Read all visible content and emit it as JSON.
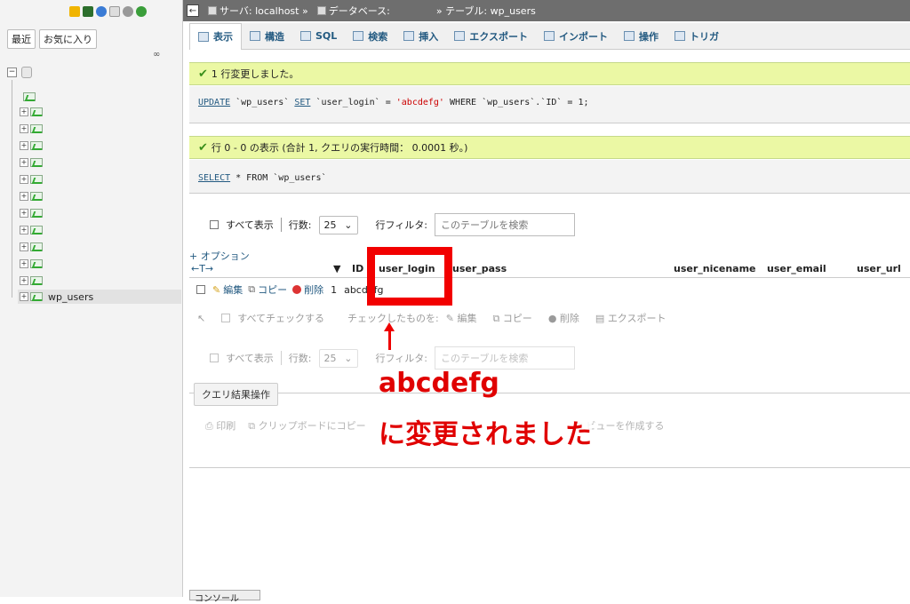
{
  "left_panel": {
    "tabs": [
      "最近",
      "お気に入り"
    ],
    "link_icon": "∞",
    "selected_table": "wp_users"
  },
  "topbar": {
    "collapse": "←",
    "server": "サーバ: localhost »",
    "database": "データベース:",
    "table": "» テーブル: wp_users"
  },
  "tabs": [
    "表示",
    "構造",
    "SQL",
    "検索",
    "挿入",
    "エクスポート",
    "インポート",
    "操作",
    "トリガ"
  ],
  "message1": {
    "text": "1 行変更しました。",
    "sql": {
      "kw1": "UPDATE",
      "t1": " `wp_users` ",
      "kw2": "SET",
      "t2": " `user_login` = ",
      "val": "'abcdefg'",
      "t3": " WHERE `wp_users`.`ID` = 1;"
    }
  },
  "message2": {
    "text": "行 0 - 0 の表示 (合計 1, クエリの実行時間： 0.0001 秒。)",
    "sql": {
      "kw1": "SELECT",
      "t1": " * FROM `wp_users`"
    }
  },
  "nav": {
    "show_all": "すべて表示",
    "rows_label": "行数:",
    "rows_value": "25",
    "filter_label": "行フィルタ:",
    "filter_placeholder": "このテーブルを検索"
  },
  "options_link": "+ オプション",
  "table": {
    "sort_arrows": "←T→",
    "columns": [
      "ID",
      "user_login",
      "user_pass",
      "user_nicename",
      "user_email",
      "user_url"
    ],
    "row": {
      "edit": "編集",
      "copy": "コピー",
      "delete": "削除",
      "id": "1",
      "user_login": "abcdefg"
    }
  },
  "with_selected": {
    "check_all": "すべてチェックする",
    "label": "チェックしたものを:",
    "edit": "編集",
    "copy": "コピー",
    "delete": "削除",
    "export": "エクスポート"
  },
  "query_ops": {
    "title": "クエリ結果操作",
    "print": "印刷",
    "clipboard": "クリップボードにコピー",
    "create_view": "ビューを作成する"
  },
  "console": "コンソール",
  "annotation": {
    "line1": "abcdefg",
    "line2": "に変更されました",
    "color": "#e00000"
  }
}
